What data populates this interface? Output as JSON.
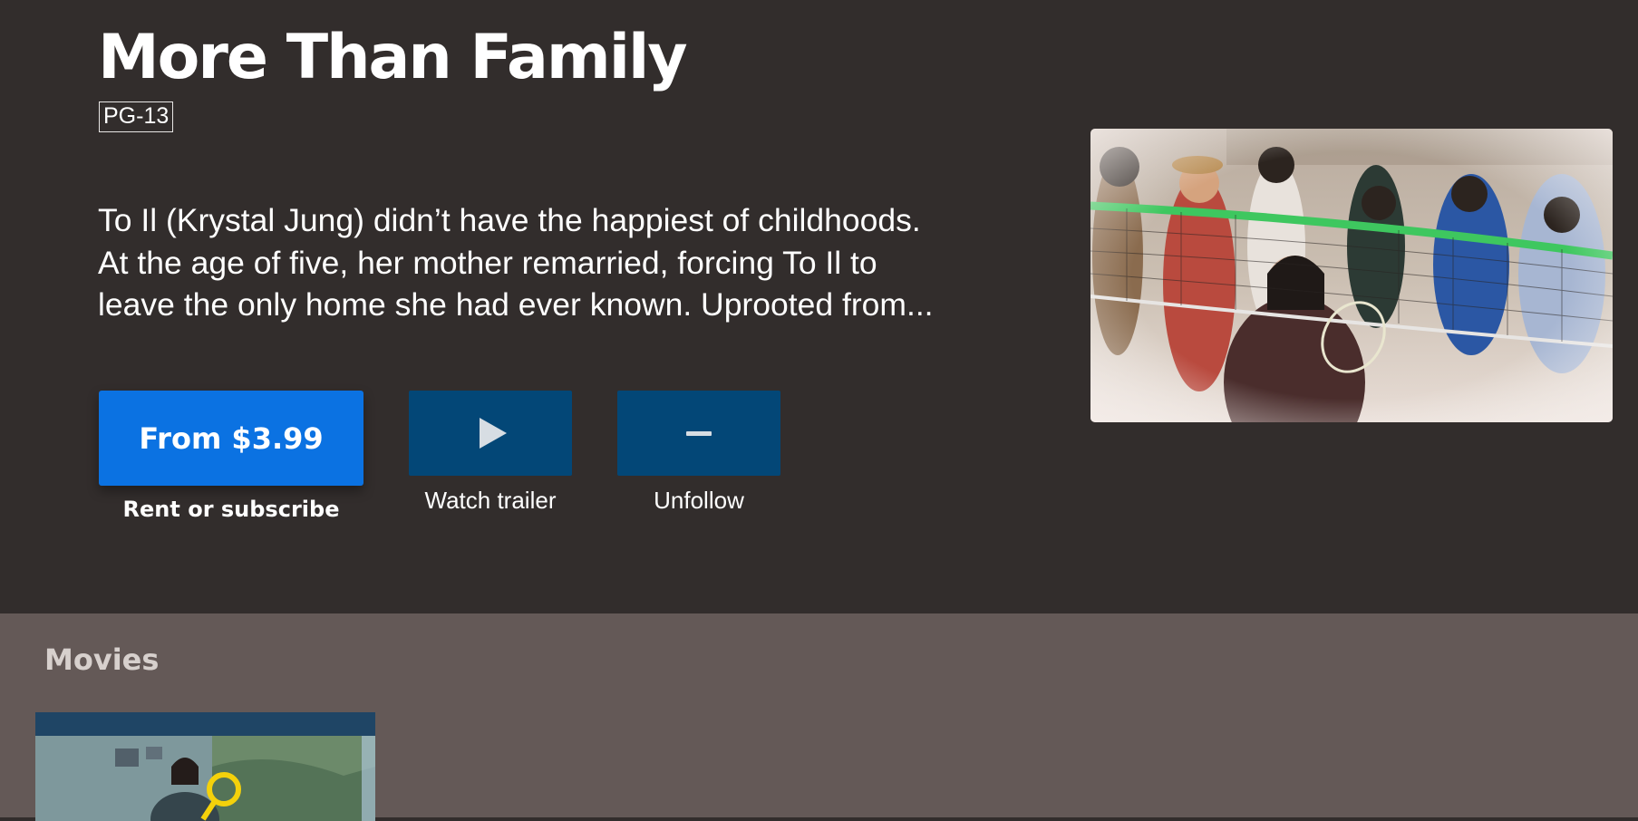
{
  "show": {
    "title": "More Than Family",
    "rating": "PG-13",
    "description_lines": [
      "To Il (Krystal Jung) didn’t have the happiest of childhoods.",
      "At the age of five, her mother remarried, forcing To Il to",
      "leave the only home she had ever known. Uprooted from..."
    ]
  },
  "actions": {
    "buy_label": "From $3.99",
    "buy_caption": "Rent or subscribe",
    "trailer_icon": "play-icon",
    "trailer_caption": "Watch trailer",
    "unfollow_icon": "minus-icon",
    "unfollow_caption": "Unfollow"
  },
  "shelf": {
    "title": "Movies"
  },
  "colors": {
    "background": "#322d2c",
    "primary_button": "#0b72e2",
    "secondary_button": "#034777",
    "shelf_background": "#645957"
  }
}
